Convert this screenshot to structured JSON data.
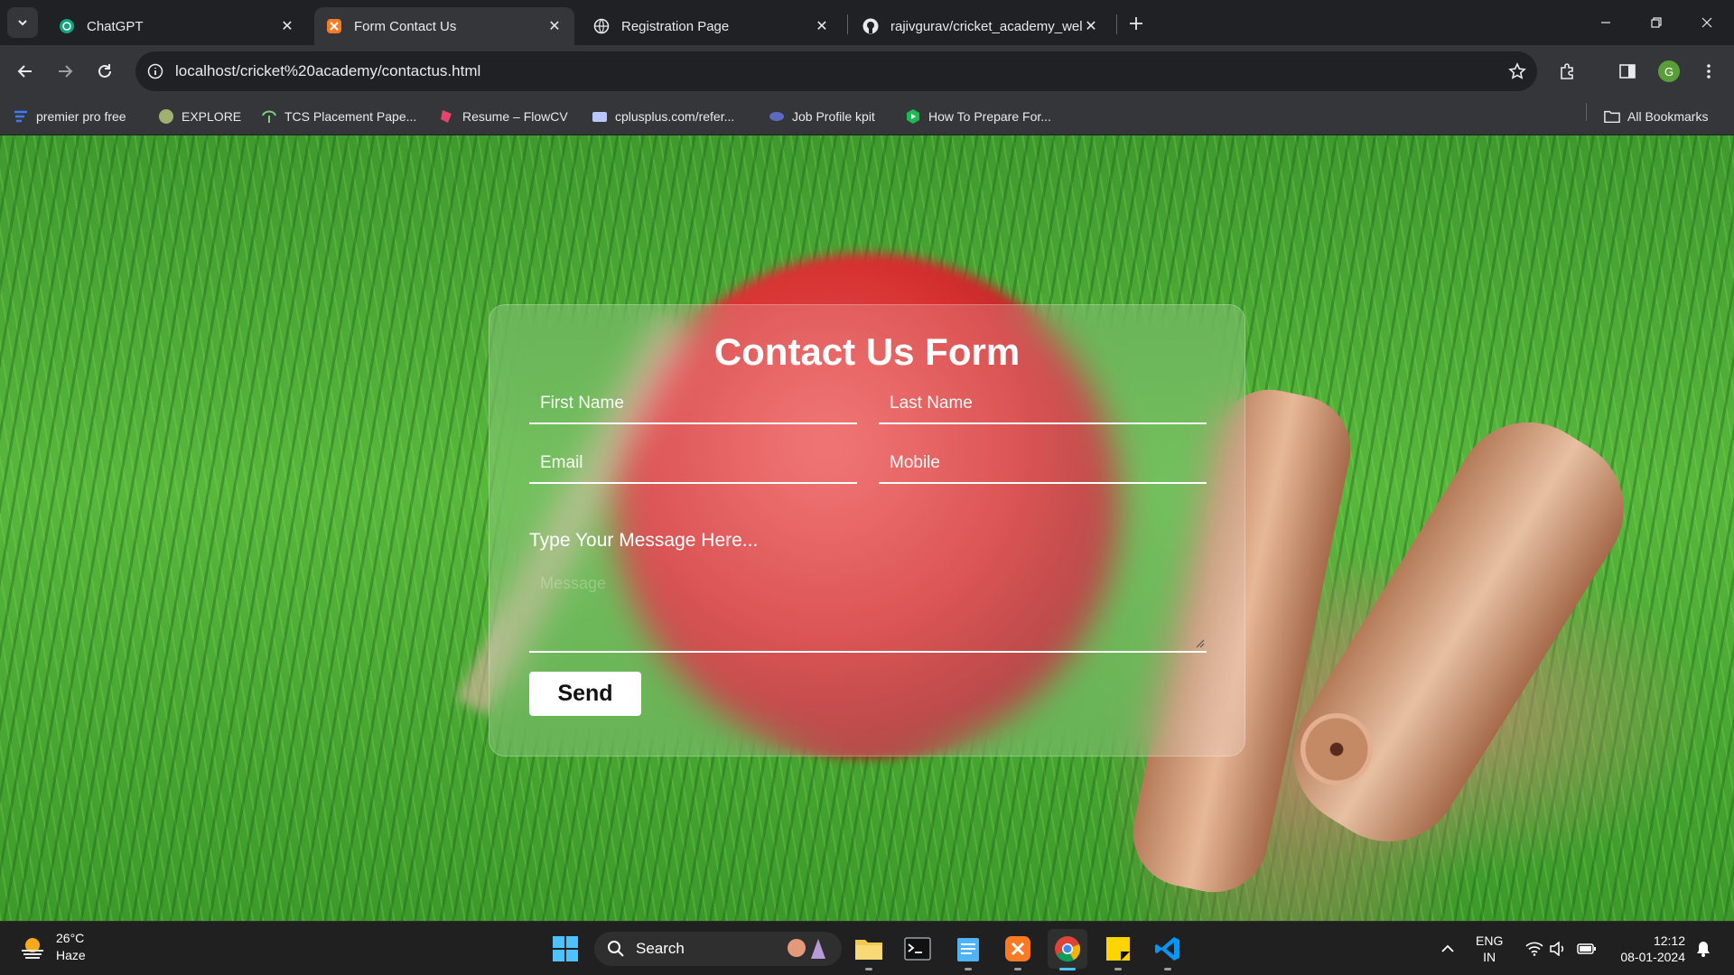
{
  "browser": {
    "tabs": [
      {
        "title": "ChatGPT",
        "favicon": "chatgpt-icon",
        "active": false
      },
      {
        "title": "Form Contact Us",
        "favicon": "xampp-icon",
        "active": true
      },
      {
        "title": "Registration Page",
        "favicon": "globe-icon",
        "active": false
      },
      {
        "title": "rajivgurav/cricket_academy_wel",
        "favicon": "github-icon",
        "active": false
      }
    ],
    "address": "localhost/cricket%20academy/contactus.html",
    "profile_initial": "G",
    "bookmarks": [
      {
        "label": "premier pro free",
        "icon": "bookmark-icon"
      },
      {
        "label": "EXPLORE",
        "icon": "bookmark-icon"
      },
      {
        "label": "TCS Placement Pape...",
        "icon": "bookmark-icon"
      },
      {
        "label": "Resume – FlowCV",
        "icon": "bookmark-icon"
      },
      {
        "label": "cplusplus.com/refer...",
        "icon": "bookmark-icon"
      },
      {
        "label": "Job Profile kpit",
        "icon": "bookmark-icon"
      },
      {
        "label": "How To Prepare For...",
        "icon": "bookmark-icon"
      }
    ],
    "all_bookmarks": "All Bookmarks"
  },
  "form": {
    "title": "Contact Us Form",
    "first_name_placeholder": "First Name",
    "last_name_placeholder": "Last Name",
    "email_placeholder": "Email",
    "mobile_placeholder": "Mobile",
    "message_label": "Type Your Message Here...",
    "message_placeholder": "Message",
    "send_label": "Send"
  },
  "taskbar": {
    "weather_temp": "26°C",
    "weather_desc": "Haze",
    "search_label": "Search",
    "lang_primary": "ENG",
    "lang_secondary": "IN",
    "time": "12:12",
    "date": "08-01-2024"
  },
  "colors": {
    "chrome_dark": "#202124",
    "chrome_toolbar": "#35363a",
    "taskbar": "#202020",
    "accent": "#4cc2ff"
  }
}
